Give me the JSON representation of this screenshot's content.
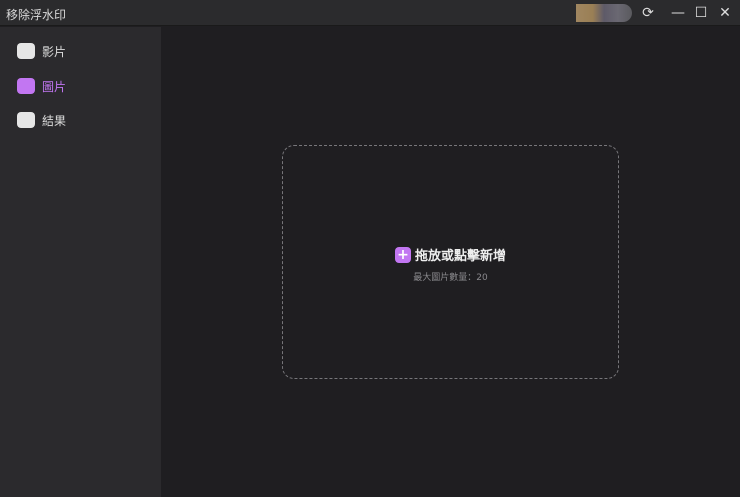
{
  "window": {
    "title": "移除浮水印"
  },
  "sidebar": {
    "items": [
      {
        "label": "影片",
        "icon": "video-icon"
      },
      {
        "label": "圖片",
        "icon": "image-icon",
        "active": true
      },
      {
        "label": "結果",
        "icon": "folder-icon"
      }
    ]
  },
  "dropzone": {
    "action": "拖放或點擊新增",
    "hint": "最大圖片數量：20"
  },
  "colors": {
    "accent": "#c276f2"
  }
}
